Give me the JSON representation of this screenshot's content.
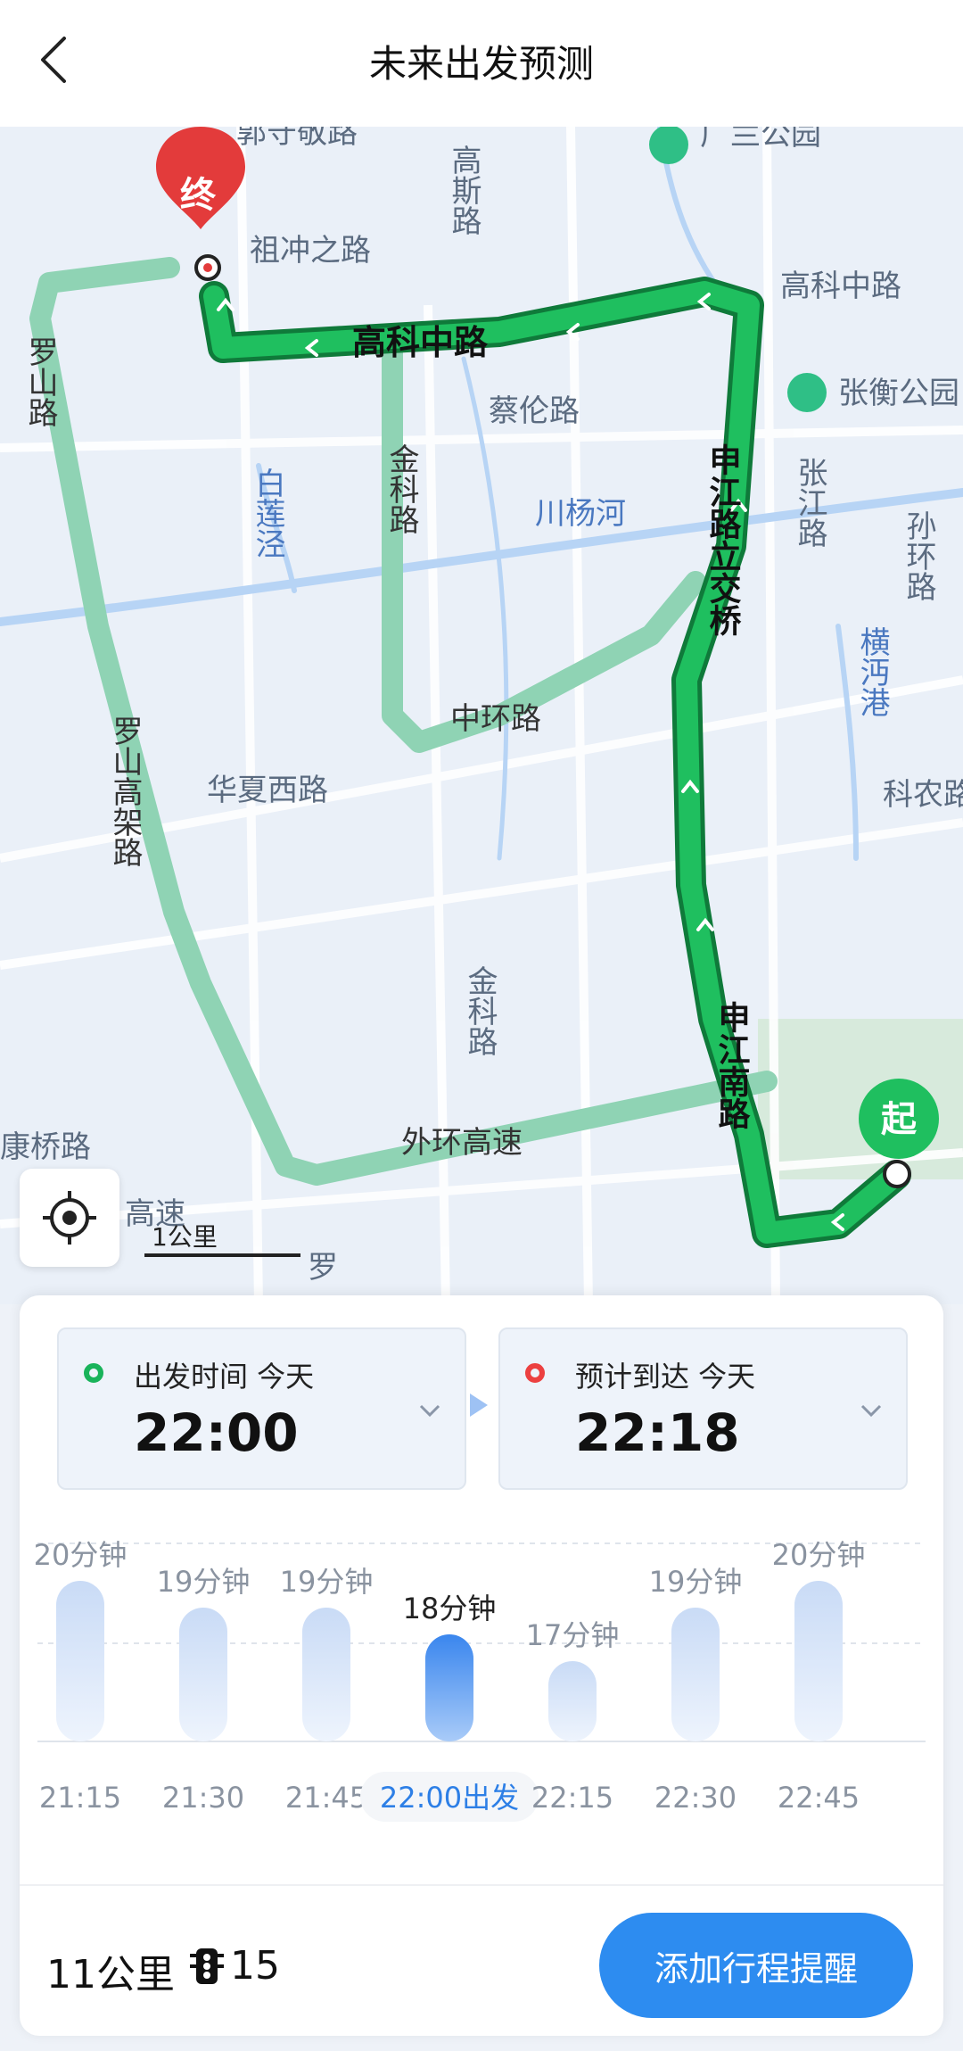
{
  "header": {
    "title": "未来出发预测",
    "back_icon": "chevron-left-icon"
  },
  "map": {
    "road_labels": [
      "郭守敬路",
      "高斯路",
      "广兰公园",
      "祖冲之路",
      "高科中路",
      "高科中路",
      "张衡公园",
      "蔡伦路",
      "罗山路",
      "金科路",
      "白莲泾",
      "川杨河",
      "申江路立交桥",
      "张江路",
      "孙环路",
      "横沔港",
      "中环路",
      "华夏西路",
      "罗山高架路",
      "科农路",
      "金科路",
      "康桥路",
      "外环高速",
      "申江南路",
      "高速",
      "罗"
    ],
    "start_marker": "起",
    "end_marker": "终",
    "scale_label": "1公里",
    "colors": {
      "route_main": "#18a950",
      "route_alt": "#8fd3b4",
      "water": "#b7d4f5",
      "park": "#d7eadc"
    }
  },
  "depart": {
    "label": "出发时间 今天",
    "time": "22:00"
  },
  "arrive": {
    "label": "预计到达 今天",
    "time": "22:18"
  },
  "chart_data": {
    "type": "bar",
    "categories": [
      "21:15",
      "21:30",
      "21:45",
      "22:00出发",
      "22:15",
      "22:30",
      "22:45"
    ],
    "values": [
      20,
      19,
      19,
      18,
      17,
      19,
      20
    ],
    "value_labels": [
      "20分钟",
      "19分钟",
      "19分钟",
      "18分钟",
      "17分钟",
      "19分钟",
      "20分钟"
    ],
    "selected_index": 3,
    "title": "",
    "xlabel": "",
    "ylabel": "",
    "grid": true
  },
  "footer": {
    "distance": "11公里",
    "traffic_lights": "15",
    "add_button": "添加行程提醒"
  }
}
